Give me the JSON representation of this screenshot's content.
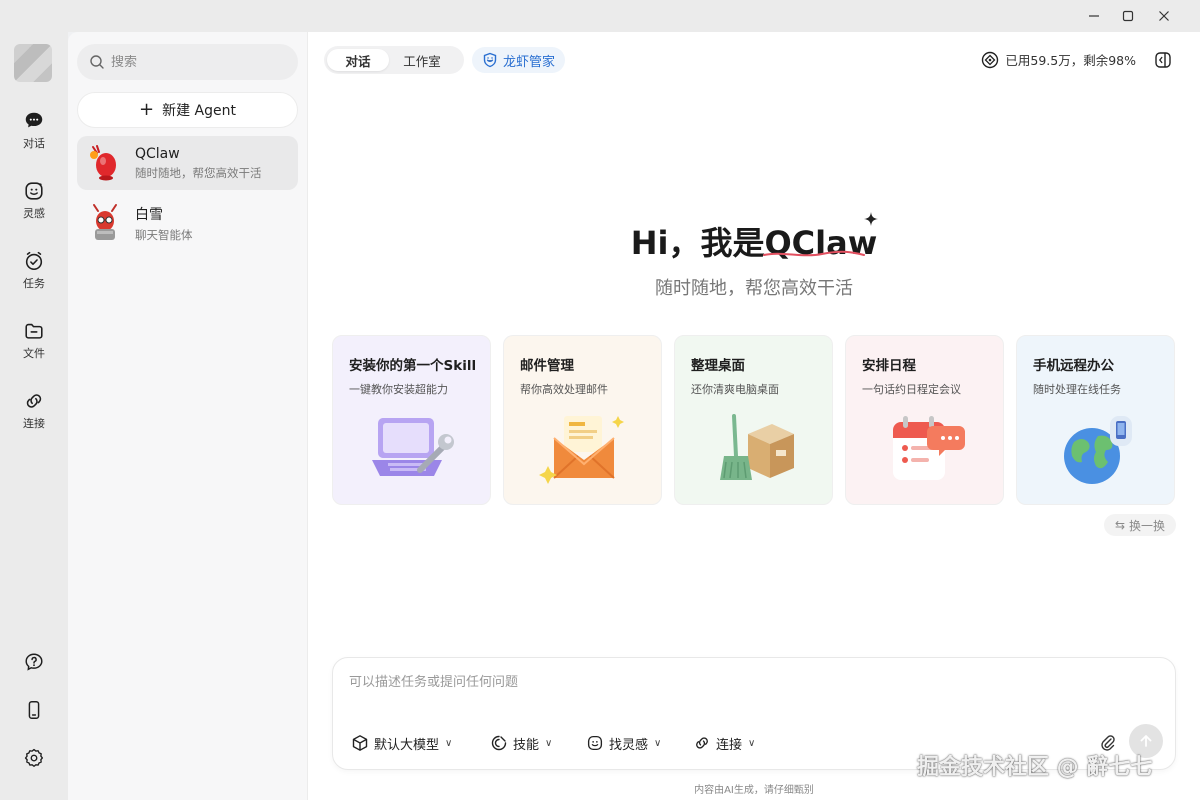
{
  "window": {
    "controls": [
      "minimize",
      "maximize",
      "close"
    ]
  },
  "rail": {
    "items": [
      {
        "label": "对话",
        "icon": "chat-bubble-icon"
      },
      {
        "label": "灵感",
        "icon": "smile-icon"
      },
      {
        "label": "任务",
        "icon": "clock-check-icon"
      },
      {
        "label": "文件",
        "icon": "folder-icon"
      },
      {
        "label": "连接",
        "icon": "link-icon"
      }
    ],
    "bottom": [
      "help-icon",
      "phone-icon",
      "settings-icon"
    ]
  },
  "panel": {
    "search_placeholder": "搜索",
    "new_agent_label": "新建 Agent",
    "agents": [
      {
        "name": "QClaw",
        "desc": "随时随地，帮您高效干活",
        "active": true
      },
      {
        "name": "白雪",
        "desc": "聊天智能体",
        "active": false
      }
    ]
  },
  "header": {
    "tabs": [
      {
        "label": "对话",
        "active": true
      },
      {
        "label": "工作室",
        "active": false
      }
    ],
    "butler_label": "龙虾管家",
    "usage_text": "已用59.5万，剩余98%"
  },
  "hero": {
    "title_prefix": "Hi，我是",
    "title_brand": "QClaw",
    "subtitle": "随时随地，帮您高效干活"
  },
  "cards": [
    {
      "title": "安装你的第一个Skill",
      "desc": "一键教你安装超能力",
      "bg": "#f3f0fc",
      "illus": "laptop-wrench"
    },
    {
      "title": "邮件管理",
      "desc": "帮你高效处理邮件",
      "bg": "#fcf6ee",
      "illus": "envelope"
    },
    {
      "title": "整理桌面",
      "desc": "还你清爽电脑桌面",
      "bg": "#f1f8f1",
      "illus": "box-broom"
    },
    {
      "title": "安排日程",
      "desc": "一句话约日程定会议",
      "bg": "#fcf2f3",
      "illus": "calendar-chat"
    },
    {
      "title": "手机远程办公",
      "desc": "随时处理在线任务",
      "bg": "#eef5fb",
      "illus": "globe-phone"
    }
  ],
  "swap_label": "换一换",
  "composer": {
    "placeholder": "可以描述任务或提问任何问题",
    "tools": [
      {
        "label": "默认大模型",
        "icon": "cube-icon"
      },
      {
        "label": "技能",
        "icon": "skill-icon"
      },
      {
        "label": "找灵感",
        "icon": "smile-icon"
      },
      {
        "label": "连接",
        "icon": "link-icon"
      }
    ]
  },
  "footnote": "内容由AI生成，请仔细甄别",
  "watermark": "掘金技术社区 @ 辭七七"
}
